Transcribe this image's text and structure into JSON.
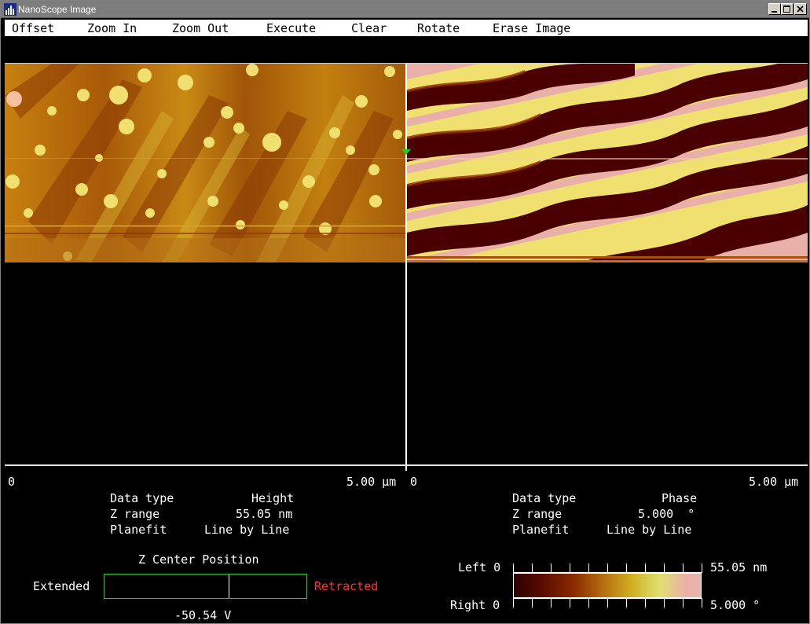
{
  "window": {
    "title": "NanoScope Image"
  },
  "menu": [
    {
      "id": "offset",
      "label": "Offset"
    },
    {
      "id": "zoom-in",
      "label": "Zoom In"
    },
    {
      "id": "zoom-out",
      "label": "Zoom Out"
    },
    {
      "id": "execute",
      "label": "Execute"
    },
    {
      "id": "clear",
      "label": "Clear"
    },
    {
      "id": "rotate",
      "label": "Rotate"
    },
    {
      "id": "erase-image",
      "label": "Erase Image"
    }
  ],
  "left_panel": {
    "axis_start": "0",
    "axis_end": "5.00 µm",
    "info": [
      {
        "label": "Data type",
        "value": "Height"
      },
      {
        "label": "Z range",
        "value": "55.05 nm"
      },
      {
        "label": "Planefit",
        "value": "Line by Line"
      }
    ]
  },
  "right_panel": {
    "axis_start": "0",
    "axis_end": "5.00 µm",
    "info": [
      {
        "label": "Data type",
        "value": "Phase"
      },
      {
        "label": "Z range",
        "value": "5.000  °"
      },
      {
        "label": "Planefit",
        "value": "Line by Line"
      }
    ]
  },
  "z_center": {
    "title": "Z Center Position",
    "extended_label": "Extended",
    "retracted_label": "Retracted",
    "value": "-50.54 V"
  },
  "colorbar": {
    "left_label": "Left 0",
    "right_label": "Right 0",
    "left_max": "55.05 nm",
    "right_max": "5.000 °"
  },
  "colors": {
    "accent_green": "#22cc22",
    "retracted_red": "#ff3333",
    "menu_bg": "#ffffff",
    "title_bg": "#7d7d7d"
  }
}
